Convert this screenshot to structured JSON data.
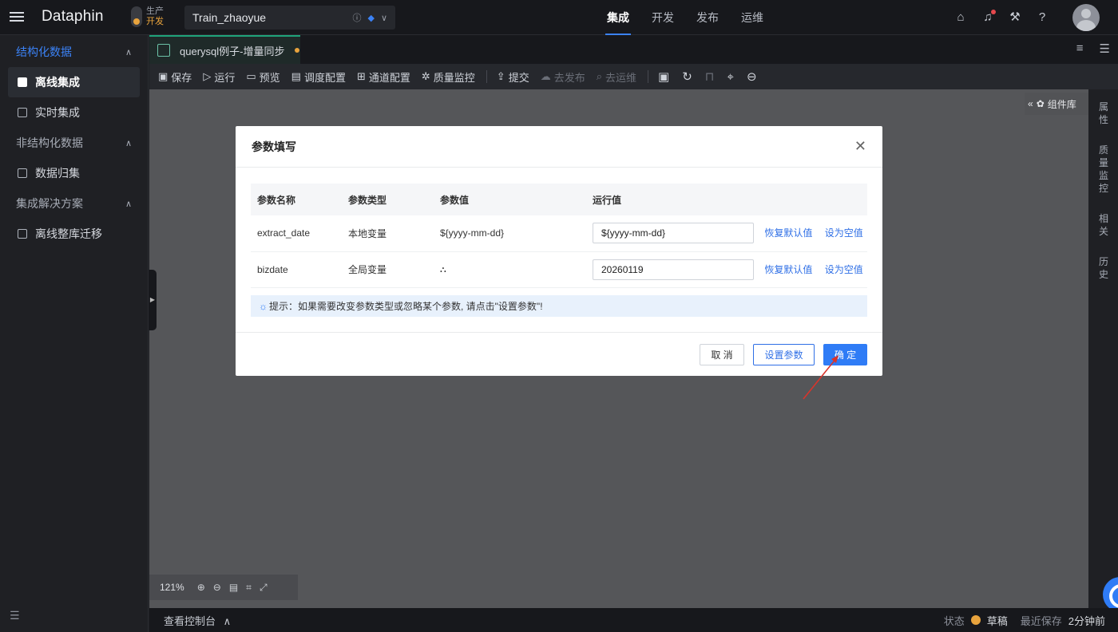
{
  "app": {
    "logo": "Dataphin"
  },
  "env": {
    "line1": "生产",
    "line2": "开发"
  },
  "project": {
    "name": "Train_zhaoyue"
  },
  "nav": {
    "items": [
      "集成",
      "开发",
      "发布",
      "运维"
    ],
    "active": 0
  },
  "sidebar": {
    "groups": [
      {
        "label": "结构化数据",
        "items": [
          "离线集成",
          "实时集成"
        ]
      },
      {
        "label": "非结构化数据",
        "items": [
          "数据归集"
        ]
      },
      {
        "label": "集成解决方案",
        "items": [
          "离线整库迁移"
        ]
      }
    ],
    "active_item": "离线集成"
  },
  "tab": {
    "label": "querysql例子-增量同步"
  },
  "toolbar": {
    "save": "保存",
    "run": "运行",
    "preview": "预览",
    "schedule": "调度配置",
    "channel": "通道配置",
    "quality": "质量监控",
    "submit": "提交",
    "publish": "去发布",
    "ops": "去运维"
  },
  "canvas": {
    "component_lib": "组件库",
    "zoom": "121%"
  },
  "right_rail": {
    "items": [
      "属性",
      "质量监控",
      "相关",
      "历史"
    ]
  },
  "statusbar": {
    "console": "查看控制台",
    "status_label": "状态",
    "status_value": "草稿",
    "saved_label": "最近保存",
    "saved_value": "2分钟前"
  },
  "modal": {
    "title": "参数填写",
    "columns": [
      "参数名称",
      "参数类型",
      "参数值",
      "运行值"
    ],
    "rows": [
      {
        "name": "extract_date",
        "type": "本地变量",
        "value": "${yyyy-mm-dd}",
        "run_value": "${yyyy-mm-dd}",
        "icon": ""
      },
      {
        "name": "bizdate",
        "type": "全局变量",
        "value": "",
        "run_value": "20260119",
        "icon": "hierarchy-icon"
      }
    ],
    "restore_label": "恢复默认值",
    "empty_label": "设为空值",
    "hint": "提示：如果需要改变参数类型或忽略某个参数, 请点击\"设置参数\"!",
    "cancel": "取 消",
    "set_params": "设置参数",
    "ok": "确 定"
  },
  "colors": {
    "accent": "#2f7cf6",
    "draft": "#e8a33d",
    "arrow": "#d9342b"
  }
}
